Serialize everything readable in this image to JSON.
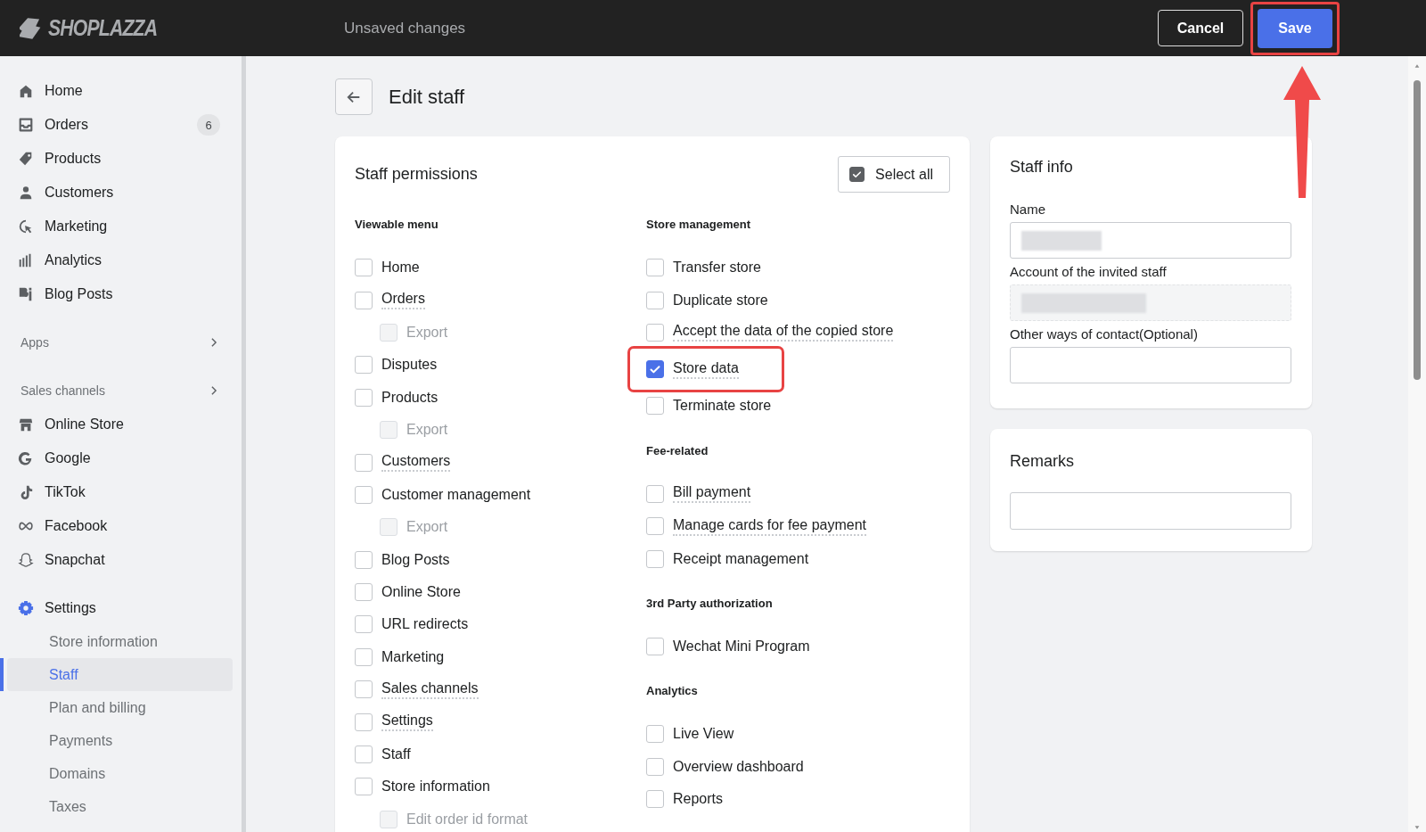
{
  "topbar": {
    "logo": "SHOPLAZZA",
    "status": "Unsaved changes",
    "cancel": {
      "label": "Cancel"
    },
    "save": {
      "label": "Save",
      "highlighted": true,
      "arrow": true
    }
  },
  "sidebar": {
    "items": [
      {
        "kind": "nav",
        "label": "Home"
      },
      {
        "kind": "nav",
        "label": "Orders",
        "badge": "6"
      },
      {
        "kind": "nav",
        "label": "Products"
      },
      {
        "kind": "nav",
        "label": "Customers"
      },
      {
        "kind": "nav",
        "label": "Marketing"
      },
      {
        "kind": "nav",
        "label": "Analytics"
      },
      {
        "kind": "nav",
        "label": "Blog Posts"
      },
      {
        "kind": "section",
        "label": "Apps"
      },
      {
        "kind": "section",
        "label": "Sales channels"
      },
      {
        "kind": "nav",
        "label": "Online Store"
      },
      {
        "kind": "nav",
        "label": "Google"
      },
      {
        "kind": "nav",
        "label": "TikTok"
      },
      {
        "kind": "nav",
        "label": "Facebook"
      },
      {
        "kind": "nav",
        "label": "Snapchat"
      },
      {
        "kind": "nav",
        "label": "Settings",
        "children": [
          {
            "label": "Store information",
            "selected": false
          },
          {
            "label": "Staff",
            "selected": true
          },
          {
            "label": "Plan and billing",
            "selected": false
          },
          {
            "label": "Payments",
            "selected": false
          },
          {
            "label": "Domains",
            "selected": false
          },
          {
            "label": "Taxes",
            "selected": false
          }
        ]
      }
    ]
  },
  "page": {
    "title": "Edit staff"
  },
  "permissions": {
    "title": "Staff permissions",
    "select_all": {
      "label": "Select all",
      "checked": true
    },
    "columns": [
      [
        {
          "title": "Viewable menu",
          "items": [
            {
              "label": "Home",
              "checked": false,
              "disabled": false,
              "underlined": false,
              "highlighted": false
            },
            {
              "label": "Orders",
              "checked": false,
              "disabled": false,
              "underlined": true,
              "highlighted": false,
              "children": [
                {
                  "label": "Export",
                  "checked": false,
                  "disabled": true,
                  "underlined": false,
                  "highlighted": false
                }
              ]
            },
            {
              "label": "Disputes",
              "checked": false,
              "disabled": false,
              "underlined": false,
              "highlighted": false
            },
            {
              "label": "Products",
              "checked": false,
              "disabled": false,
              "underlined": false,
              "highlighted": false,
              "children": [
                {
                  "label": "Export",
                  "checked": false,
                  "disabled": true,
                  "underlined": false,
                  "highlighted": false
                }
              ]
            },
            {
              "label": "Customers",
              "checked": false,
              "disabled": false,
              "underlined": true,
              "highlighted": false
            },
            {
              "label": "Customer management",
              "checked": false,
              "disabled": false,
              "underlined": false,
              "highlighted": false,
              "children": [
                {
                  "label": "Export",
                  "checked": false,
                  "disabled": true,
                  "underlined": false,
                  "highlighted": false
                }
              ]
            },
            {
              "label": "Blog Posts",
              "checked": false,
              "disabled": false,
              "underlined": false,
              "highlighted": false
            },
            {
              "label": "Online Store",
              "checked": false,
              "disabled": false,
              "underlined": false,
              "highlighted": false
            },
            {
              "label": "URL redirects",
              "checked": false,
              "disabled": false,
              "underlined": false,
              "highlighted": false
            },
            {
              "label": "Marketing",
              "checked": false,
              "disabled": false,
              "underlined": false,
              "highlighted": false
            },
            {
              "label": "Sales channels",
              "checked": false,
              "disabled": false,
              "underlined": true,
              "highlighted": false
            },
            {
              "label": "Settings",
              "checked": false,
              "disabled": false,
              "underlined": true,
              "highlighted": false
            },
            {
              "label": "Staff",
              "checked": false,
              "disabled": false,
              "underlined": false,
              "highlighted": false
            },
            {
              "label": "Store information",
              "checked": false,
              "disabled": false,
              "underlined": false,
              "highlighted": false,
              "children": [
                {
                  "label": "Edit order id format",
                  "checked": false,
                  "disabled": true,
                  "underlined": false,
                  "highlighted": false
                }
              ]
            }
          ]
        }
      ],
      [
        {
          "title": "Store management",
          "items": [
            {
              "label": "Transfer store",
              "checked": false,
              "disabled": false,
              "underlined": false,
              "highlighted": false
            },
            {
              "label": "Duplicate store",
              "checked": false,
              "disabled": false,
              "underlined": false,
              "highlighted": false
            },
            {
              "label": "Accept the data of the copied store",
              "checked": false,
              "disabled": false,
              "underlined": true,
              "highlighted": false
            },
            {
              "label": "Store data",
              "checked": true,
              "disabled": false,
              "underlined": true,
              "highlighted": true
            },
            {
              "label": "Terminate store",
              "checked": false,
              "disabled": false,
              "underlined": false,
              "highlighted": false
            }
          ]
        },
        {
          "title": "Fee-related",
          "items": [
            {
              "label": "Bill payment",
              "checked": false,
              "disabled": false,
              "underlined": true,
              "highlighted": false
            },
            {
              "label": "Manage cards for fee payment",
              "checked": false,
              "disabled": false,
              "underlined": true,
              "highlighted": false
            },
            {
              "label": "Receipt management",
              "checked": false,
              "disabled": false,
              "underlined": false,
              "highlighted": false
            }
          ]
        },
        {
          "title": "3rd Party authorization",
          "items": [
            {
              "label": "Wechat Mini Program",
              "checked": false,
              "disabled": false,
              "underlined": false,
              "highlighted": false
            }
          ]
        },
        {
          "title": "Analytics",
          "items": [
            {
              "label": "Live View",
              "checked": false,
              "disabled": false,
              "underlined": false,
              "highlighted": false
            },
            {
              "label": "Overview dashboard",
              "checked": false,
              "disabled": false,
              "underlined": false,
              "highlighted": false
            },
            {
              "label": "Reports",
              "checked": false,
              "disabled": false,
              "underlined": false,
              "highlighted": false
            }
          ]
        }
      ]
    ]
  },
  "staff_info": {
    "title": "Staff info",
    "fields": [
      {
        "label": "Name",
        "redacted": true,
        "disabled": false
      },
      {
        "label": "Account of the invited staff",
        "redacted": true,
        "disabled": true
      },
      {
        "label": "Other ways of contact(Optional)",
        "redacted": false,
        "disabled": false
      }
    ]
  },
  "remarks": {
    "title": "Remarks"
  }
}
